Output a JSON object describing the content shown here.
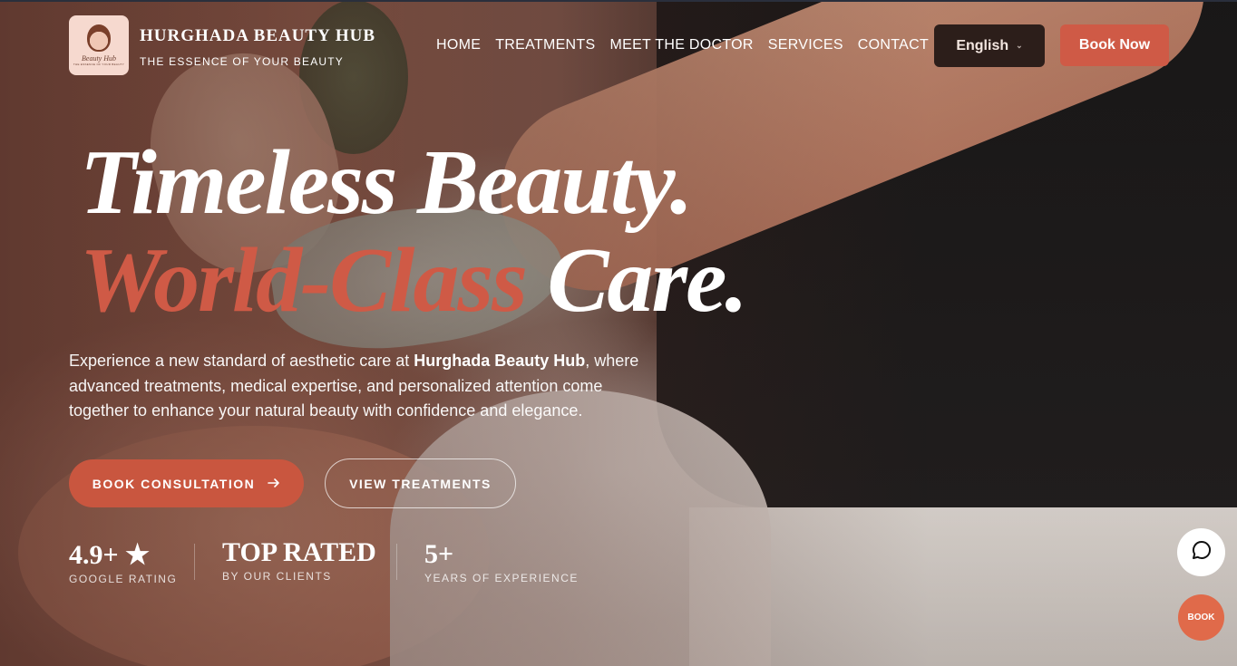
{
  "header": {
    "brand_name": "HURGHADA BEAUTY HUB",
    "brand_tagline": "THE ESSENCE OF YOUR BEAUTY",
    "logo_text": "Beauty Hub",
    "logo_subtext": "THE ESSENCE OF YOUR BEAUTY",
    "nav": [
      "HOME",
      "TREATMENTS",
      "MEET THE DOCTOR",
      "SERVICES",
      "CONTACT"
    ],
    "language": "English",
    "book_now_label": "Book Now"
  },
  "hero": {
    "line1": "Timeless Beauty.",
    "line2_accent": "World-Class",
    "line2_rest": "Care.",
    "intro_before": "Experience a new standard of aesthetic care at ",
    "intro_bold": "Hurghada Beauty Hub",
    "intro_after": ", where advanced treatments, medical expertise, and personalized attention come together to enhance your natural beauty with confidence and elegance.",
    "primary_cta": "BOOK CONSULTATION",
    "secondary_cta": "VIEW TREATMENTS"
  },
  "stats": [
    {
      "value": "4.9+ ★",
      "label": "GOOGLE RATING"
    },
    {
      "value": "TOP RATED",
      "label": "BY OUR CLIENTS"
    },
    {
      "value": "5+",
      "label": "YEARS OF EXPERIENCE"
    }
  ],
  "floating": {
    "chat_icon": "chat-bubble-icon",
    "book_label": "BOOK"
  },
  "colors": {
    "accent": "#cf5a46",
    "fab": "#e06a4a",
    "lang_bg": "#2c1e1a"
  }
}
